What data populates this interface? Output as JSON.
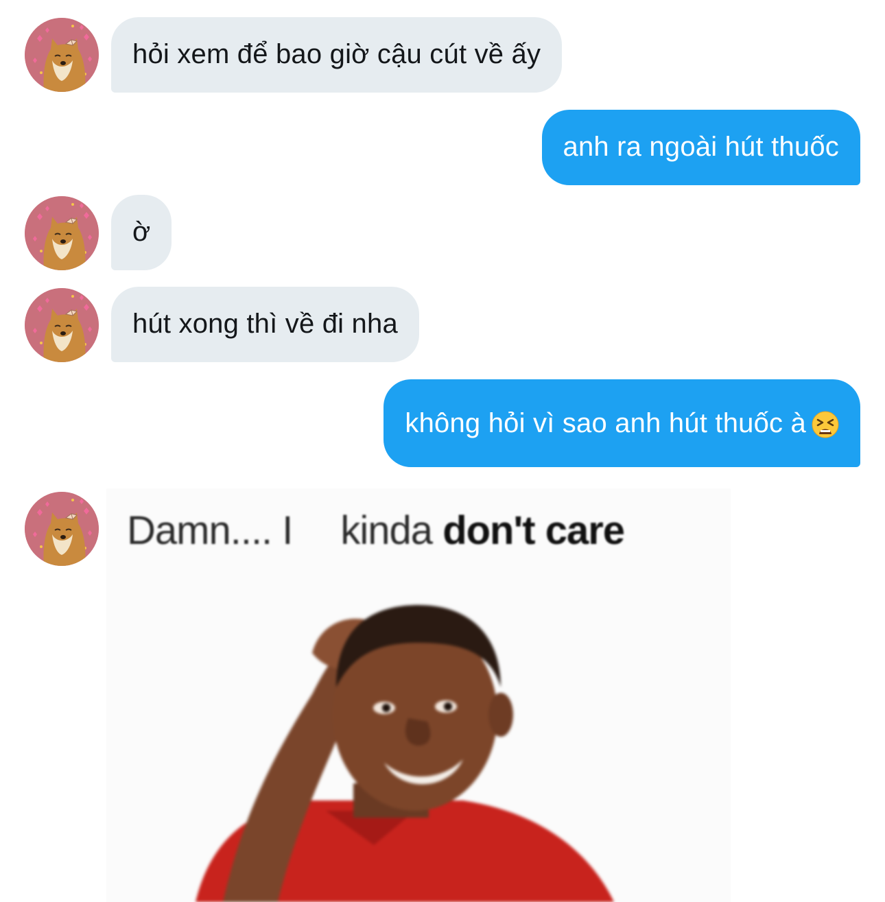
{
  "conversation": {
    "messages": [
      {
        "direction": "incoming",
        "text": "hỏi xem để bao giờ cậu cút về ấy"
      },
      {
        "direction": "outgoing",
        "text": "anh ra ngoài hút thuốc"
      },
      {
        "direction": "incoming",
        "text": "ờ"
      },
      {
        "direction": "incoming",
        "text": "hút xong thì về đi nha"
      },
      {
        "direction": "outgoing",
        "text": "không hỏi vì sao anh hút thuốc à",
        "emoji": "tired-face-emoji"
      },
      {
        "direction": "incoming",
        "type": "image",
        "image": "meme-kid-scratching-head"
      }
    ]
  },
  "meme": {
    "caption_part1": "Damn.... I",
    "caption_part2": "kinda",
    "caption_bold": "don't care"
  },
  "colors": {
    "incoming_bubble": "#e6ecf0",
    "outgoing_bubble": "#1da1f2",
    "avatar_background": "#c9707c"
  }
}
